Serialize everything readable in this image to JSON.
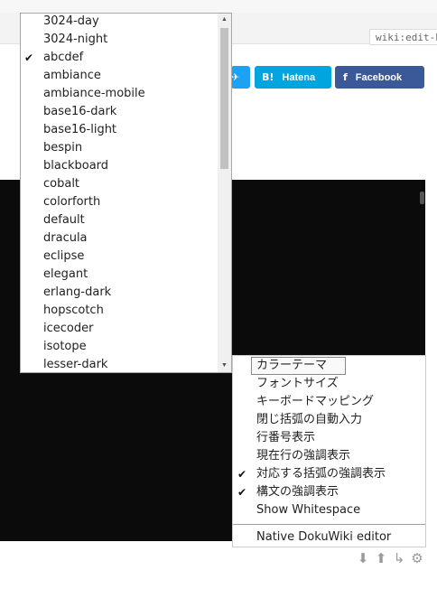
{
  "page": {
    "tab_label": "wiki:edit-help"
  },
  "share_buttons": [
    {
      "label": "",
      "icon": "twitter-bird-icon",
      "color": "#1da1f2"
    },
    {
      "label": "Hatena",
      "icon_text": "B!",
      "color": "#00a4de"
    },
    {
      "label": "Facebook",
      "icon_text": "f",
      "color": "#3b5998"
    }
  ],
  "theme_dropdown": {
    "selected": "abcdef",
    "options": [
      {
        "label": "3024-day",
        "checked": false
      },
      {
        "label": "3024-night",
        "checked": false
      },
      {
        "label": "abcdef",
        "checked": true
      },
      {
        "label": "ambiance",
        "checked": false
      },
      {
        "label": "ambiance-mobile",
        "checked": false
      },
      {
        "label": "base16-dark",
        "checked": false
      },
      {
        "label": "base16-light",
        "checked": false
      },
      {
        "label": "bespin",
        "checked": false
      },
      {
        "label": "blackboard",
        "checked": false
      },
      {
        "label": "cobalt",
        "checked": false
      },
      {
        "label": "colorforth",
        "checked": false
      },
      {
        "label": "default",
        "checked": false
      },
      {
        "label": "dracula",
        "checked": false
      },
      {
        "label": "eclipse",
        "checked": false
      },
      {
        "label": "elegant",
        "checked": false
      },
      {
        "label": "erlang-dark",
        "checked": false
      },
      {
        "label": "hopscotch",
        "checked": false
      },
      {
        "label": "icecoder",
        "checked": false
      },
      {
        "label": "isotope",
        "checked": false
      },
      {
        "label": "lesser-dark",
        "checked": false
      }
    ]
  },
  "settings_menu": {
    "items": [
      {
        "label": "カラーテーマ",
        "checked": false,
        "hovered": true
      },
      {
        "label": "フォントサイズ",
        "checked": false
      },
      {
        "label": "キーボードマッピング",
        "checked": false
      },
      {
        "label": "閉じ括弧の自動入力",
        "checked": false
      },
      {
        "label": "行番号表示",
        "checked": false
      },
      {
        "label": "現在行の強調表示",
        "checked": false
      },
      {
        "label": "対応する括弧の強調表示",
        "checked": true
      },
      {
        "label": "構文の強調表示",
        "checked": true
      },
      {
        "label": "Show Whitespace",
        "checked": false
      }
    ],
    "footer_item": "Native DokuWiki editor"
  },
  "editor_footer_icons": [
    "arrow-down-icon",
    "arrow-up-icon",
    "return-arrow-icon",
    "gear-icon"
  ],
  "glyphs": {
    "check": "✔",
    "scroll_up": "▲",
    "scroll_down": "▼",
    "twitter": "✈",
    "arrow_down": "⬇",
    "arrow_up": "⬆",
    "return": "↳",
    "gear": "⚙"
  },
  "colors": {
    "editor_bg": "#0b0b0b",
    "menu_border": "#a8a8a8"
  }
}
